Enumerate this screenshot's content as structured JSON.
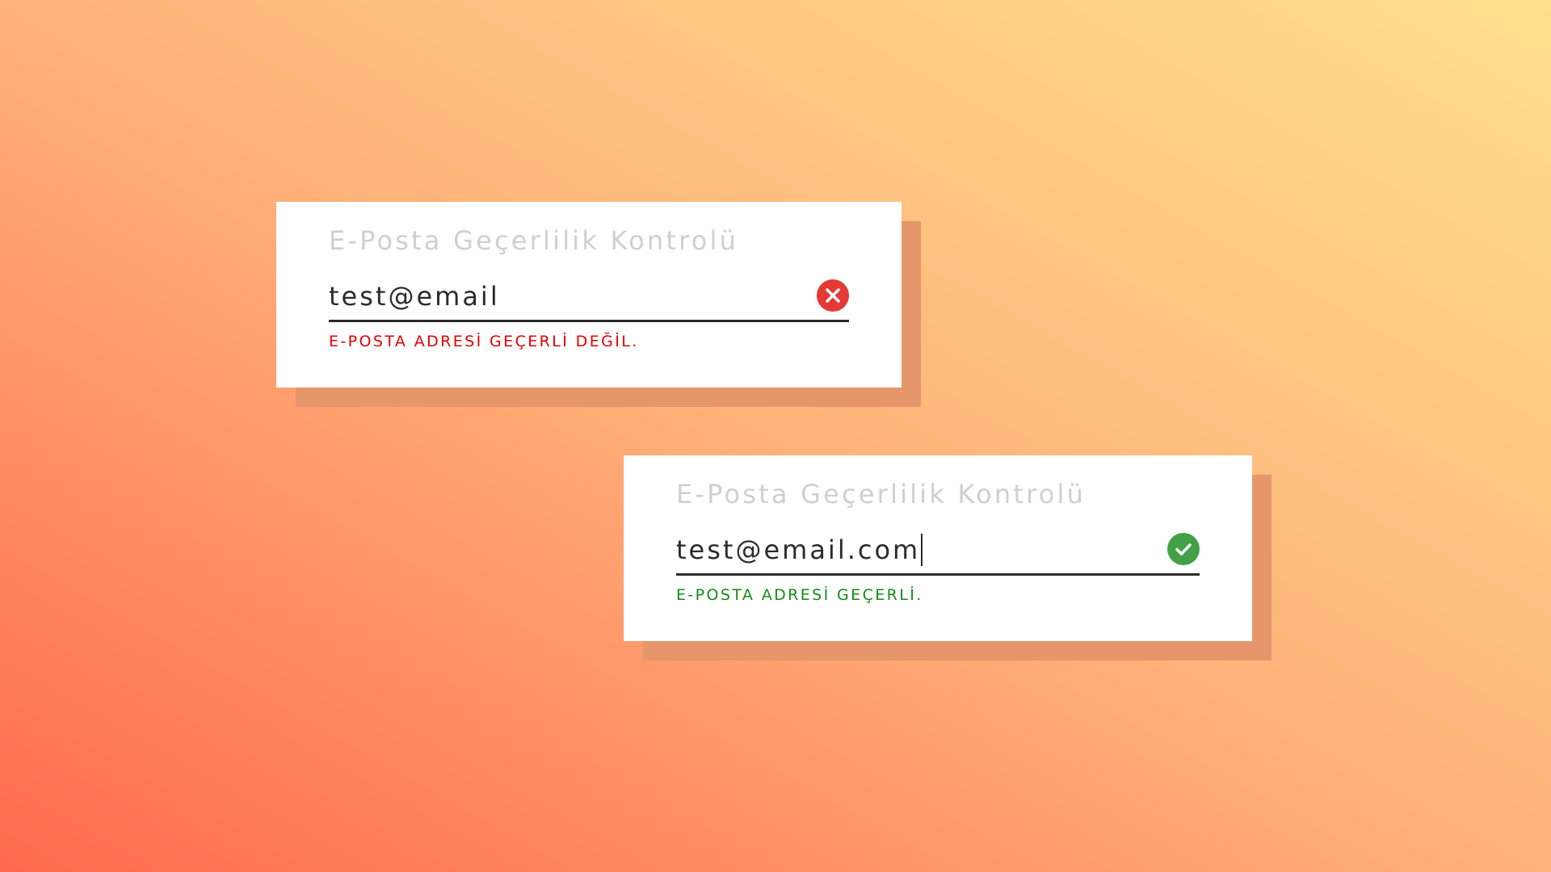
{
  "colors": {
    "background_gradient_start": "#ff6a4d",
    "background_gradient_mid": "#ffb27a",
    "background_gradient_end": "#ffe08d",
    "shadow": "#e5966a",
    "title": "#cfcfcf",
    "input_text": "#2b2b2b",
    "error": "#e53935",
    "error_text": "#e60000",
    "success": "#43a047",
    "success_text": "#148a14"
  },
  "cards": [
    {
      "title": "E-Posta Geçerlilik Kontrolü",
      "email_value": "test@email",
      "status": "invalid",
      "status_icon": "error-x-icon",
      "message": "E-POSTA ADRESİ GEÇERLİ DEĞİL."
    },
    {
      "title": "E-Posta Geçerlilik Kontrolü",
      "email_value": "test@email.com",
      "status": "valid",
      "status_icon": "check-icon",
      "message": "E-POSTA ADRESİ GEÇERLİ."
    }
  ]
}
